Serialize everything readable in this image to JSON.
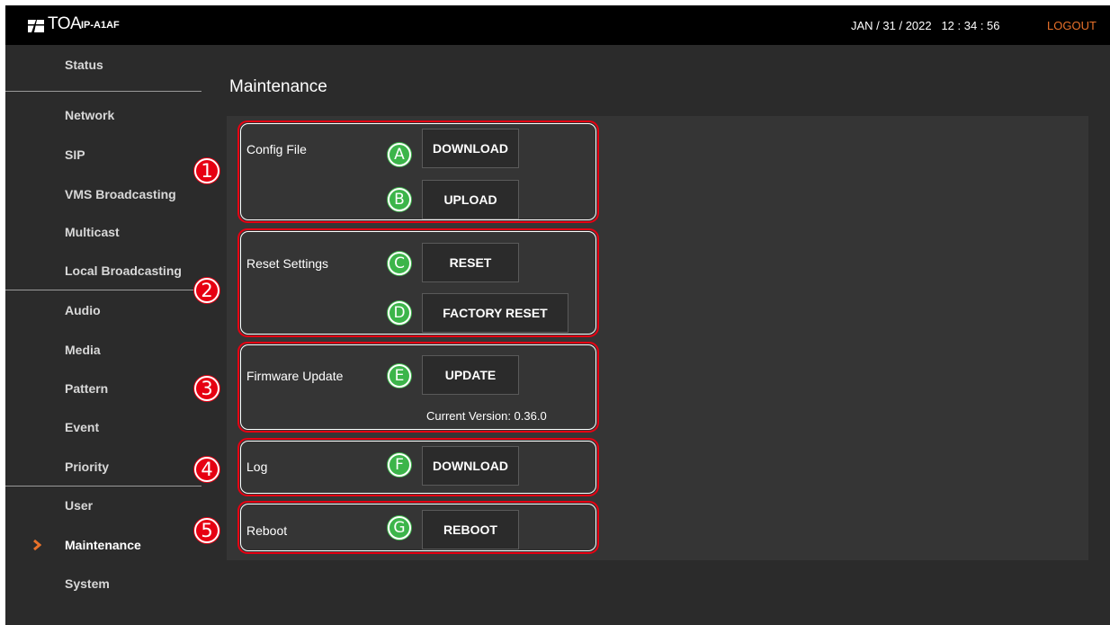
{
  "header": {
    "brand": "TOA",
    "model": "IP-A1AF",
    "datetime": "JAN / 31 / 2022   12 : 34 : 56",
    "logout_label": "LOGOUT",
    "logout_color": "#e8712a"
  },
  "sidebar": {
    "items": [
      {
        "label": "Status"
      },
      {
        "label": "Network"
      },
      {
        "label": "SIP"
      },
      {
        "label": "VMS Broadcasting"
      },
      {
        "label": "Multicast"
      },
      {
        "label": "Local Broadcasting"
      },
      {
        "label": "Audio"
      },
      {
        "label": "Media"
      },
      {
        "label": "Pattern"
      },
      {
        "label": "Event"
      },
      {
        "label": "Priority"
      },
      {
        "label": "User"
      },
      {
        "label": "Maintenance",
        "active": true,
        "icon": "chevron-right-icon"
      },
      {
        "label": "System"
      }
    ]
  },
  "main": {
    "title": "Maintenance",
    "sections": [
      {
        "marker": "1",
        "label": "Config File",
        "buttons": [
          {
            "marker": "A",
            "label": "DOWNLOAD"
          },
          {
            "marker": "B",
            "label": "UPLOAD"
          }
        ]
      },
      {
        "marker": "2",
        "label": "Reset Settings",
        "buttons": [
          {
            "marker": "C",
            "label": "RESET"
          },
          {
            "marker": "D",
            "label": "FACTORY RESET"
          }
        ]
      },
      {
        "marker": "3",
        "label": "Firmware Update",
        "buttons": [
          {
            "marker": "E",
            "label": "UPDATE"
          }
        ],
        "version_text": "Current Version: 0.36.0"
      },
      {
        "marker": "4",
        "label": "Log",
        "buttons": [
          {
            "marker": "F",
            "label": "DOWNLOAD"
          }
        ]
      },
      {
        "marker": "5",
        "label": "Reboot",
        "buttons": [
          {
            "marker": "G",
            "label": "REBOOT"
          }
        ]
      }
    ]
  },
  "colors": {
    "background": "#2b2b2b",
    "panel": "#353535",
    "header": "#000000",
    "section_outline": "#e60012",
    "red_marker": "#e60012",
    "green_marker": "#3cb54a",
    "accent": "#e8712a"
  }
}
